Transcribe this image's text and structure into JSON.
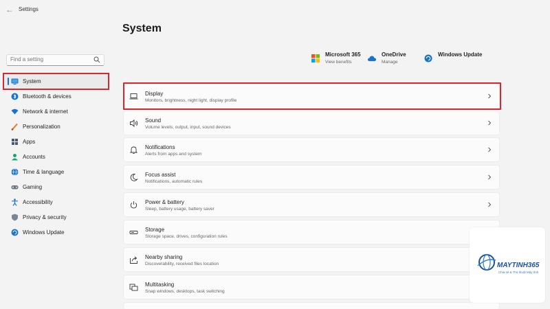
{
  "window": {
    "title": "Settings"
  },
  "search": {
    "placeholder": "Find a setting"
  },
  "sidebar": {
    "items": [
      {
        "label": "System",
        "icon": "monitor-icon",
        "active": true
      },
      {
        "label": "Bluetooth & devices",
        "icon": "bluetooth-icon"
      },
      {
        "label": "Network & internet",
        "icon": "wifi-icon"
      },
      {
        "label": "Personalization",
        "icon": "brush-icon"
      },
      {
        "label": "Apps",
        "icon": "apps-icon"
      },
      {
        "label": "Accounts",
        "icon": "person-icon"
      },
      {
        "label": "Time & language",
        "icon": "globe-clock-icon"
      },
      {
        "label": "Gaming",
        "icon": "gamepad-icon"
      },
      {
        "label": "Accessibility",
        "icon": "accessibility-icon"
      },
      {
        "label": "Privacy & security",
        "icon": "shield-icon"
      },
      {
        "label": "Windows Update",
        "icon": "update-icon"
      }
    ]
  },
  "main": {
    "title": "System",
    "quick_links": [
      {
        "title": "Microsoft 365",
        "subtitle": "View benefits",
        "icon": "microsoft-logo-icon"
      },
      {
        "title": "OneDrive",
        "subtitle": "Manage",
        "icon": "cloud-icon"
      },
      {
        "title": "Windows Update",
        "subtitle": "",
        "icon": "update-icon"
      }
    ],
    "cards": [
      {
        "title": "Display",
        "subtitle": "Monitors, brightness, night light, display profile",
        "icon": "laptop-icon"
      },
      {
        "title": "Sound",
        "subtitle": "Volume levels, output, input, sound devices",
        "icon": "speaker-icon"
      },
      {
        "title": "Notifications",
        "subtitle": "Alerts from apps and system",
        "icon": "bell-icon"
      },
      {
        "title": "Focus assist",
        "subtitle": "Notifications, automatic rules",
        "icon": "moon-icon"
      },
      {
        "title": "Power & battery",
        "subtitle": "Sleep, battery usage, battery saver",
        "icon": "power-icon"
      },
      {
        "title": "Storage",
        "subtitle": "Storage space, drives, configuration rules",
        "icon": "storage-icon"
      },
      {
        "title": "Nearby sharing",
        "subtitle": "Discoverability, received files location",
        "icon": "share-icon"
      },
      {
        "title": "Multitasking",
        "subtitle": "Snap windows, desktops, task switching",
        "icon": "multitask-icon"
      }
    ]
  },
  "watermark": {
    "brand": "MAYTINH365",
    "tagline": "Chia sẻ & Thủ thuật Máy tính"
  },
  "colors": {
    "accent": "#1a6fd0",
    "highlight": "#d6262e",
    "background": "#f3f3f3",
    "card": "#fbfbfb"
  }
}
